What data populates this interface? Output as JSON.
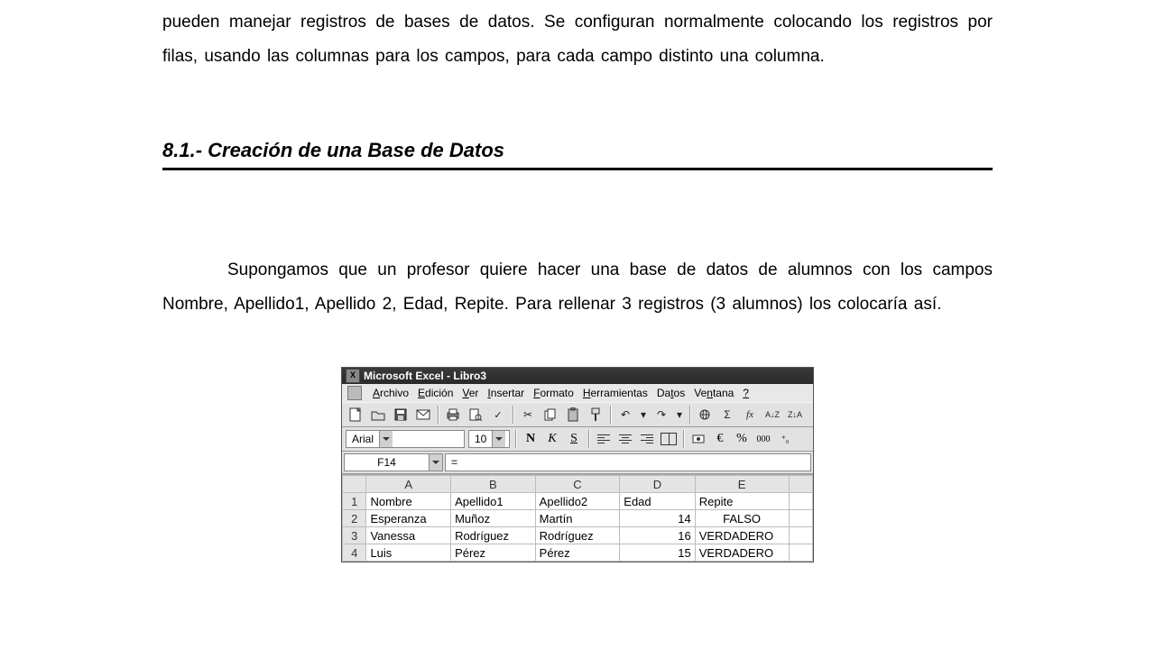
{
  "doc": {
    "intro": "pueden manejar registros de bases de datos. Se configuran normalmente colocando los registros por filas, usando las columnas para los campos, para cada campo distinto una columna.",
    "heading": "8.1.- Creación de una Base de Datos",
    "body": "Supongamos que un profesor quiere hacer una base de datos de alumnos con los campos Nombre, Apellido1, Apellido 2, Edad, Repite. Para rellenar 3 registros (3 alumnos) los colocaría así."
  },
  "excel": {
    "title": "Microsoft Excel - Libro3",
    "menus": {
      "archivo": "Archivo",
      "edicion": "Edición",
      "ver": "Ver",
      "insertar": "Insertar",
      "formato": "Formato",
      "herramientas": "Herramientas",
      "datos": "Datos",
      "ventana": "Ventana",
      "ayuda": "?"
    },
    "format": {
      "font": "Arial",
      "size": "10",
      "bold_label": "N",
      "italic_label": "K",
      "underline_label": "S",
      "currency": "€",
      "percent": "%",
      "thousands": "000",
      "sigma": "Σ",
      "fx": "fx",
      "sort_az": "A↓Z",
      "sort_za": "Z↓A"
    },
    "cellref": "F14",
    "formula_prefix": "=",
    "col_headers": [
      "A",
      "B",
      "C",
      "D",
      "E",
      ""
    ],
    "rows": [
      {
        "n": "1",
        "a": "Nombre",
        "b": "Apellido1",
        "c": "Apellido2",
        "d": "Edad",
        "e": "Repite",
        "e_align": "left",
        "d_align": "left"
      },
      {
        "n": "2",
        "a": "Esperanza",
        "b": "Muñoz",
        "c": "Martín",
        "d": "14",
        "e": "FALSO",
        "e_align": "center",
        "d_align": "right"
      },
      {
        "n": "3",
        "a": "Vanessa",
        "b": "Rodríguez",
        "c": "Rodríguez",
        "d": "16",
        "e": "VERDADERO",
        "e_align": "left",
        "d_align": "right"
      },
      {
        "n": "4",
        "a": "Luis",
        "b": "Pérez",
        "c": "Pérez",
        "d": "15",
        "e": "VERDADERO",
        "e_align": "left",
        "d_align": "right"
      }
    ]
  }
}
